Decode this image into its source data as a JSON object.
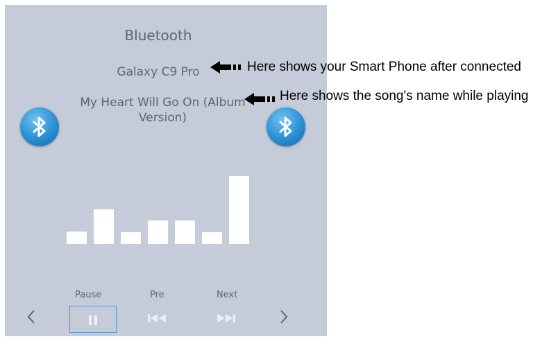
{
  "screen": {
    "title": "Bluetooth",
    "device_name": "Galaxy C9 Pro",
    "song_title": "My Heart Will Go On (Album Version)"
  },
  "equalizer": {
    "levels": [
      0.18,
      0.51,
      0.17,
      0.35,
      0.35,
      0.17,
      1.0
    ]
  },
  "controls": {
    "pause_label": "Pause",
    "pre_label": "Pre",
    "next_label": "Next"
  },
  "annotations": {
    "device_note": "Here shows your Smart Phone after connected",
    "song_note": "Here shows the song's name while playing"
  },
  "icons": {
    "bluetooth": "bluetooth-icon",
    "back": "chevron-left-icon",
    "forward": "chevron-right-icon",
    "pause": "pause-icon",
    "previous": "skip-previous-icon",
    "next": "skip-next-icon",
    "pointer": "arrow-left-icon"
  },
  "colors": {
    "screen_background": "#c5cbd9",
    "bluetooth_blue": "#2b8fd3",
    "selection_border": "#4e96d2",
    "bars": "#ffffff"
  }
}
